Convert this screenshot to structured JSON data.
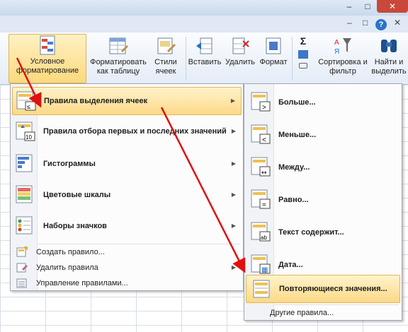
{
  "window": {
    "minimize": "–",
    "maximize": "□",
    "close": "✕",
    "sub_minimize": "–",
    "sub_restore": "□",
    "sub_close": "✕",
    "help": "?"
  },
  "ribbon": {
    "conditional_formatting": "Условное форматирование",
    "format_as_table": "Форматировать как таблицу",
    "cell_styles": "Стили ячеек",
    "insert": "Вставить",
    "delete": "Удалить",
    "format": "Формат",
    "sort_filter": "Сортировка и фильтр",
    "find_select": "Найти и выделить",
    "sigma": "Σ"
  },
  "menu_main": {
    "items": [
      {
        "label": "Правила выделения ячеек",
        "icon": "highlight-rules-icon"
      },
      {
        "label": "Правила отбора первых и последних значений",
        "icon": "top-bottom-icon"
      },
      {
        "label": "Гистограммы",
        "icon": "data-bars-icon"
      },
      {
        "label": "Цветовые шкалы",
        "icon": "color-scales-icon"
      },
      {
        "label": "Наборы значков",
        "icon": "icon-sets-icon"
      }
    ],
    "small_items": [
      {
        "label": "Создать правило..."
      },
      {
        "label": "Удалить правила"
      },
      {
        "label": "Управление правилами..."
      }
    ]
  },
  "menu_sub": {
    "items": [
      {
        "label": "Больше...",
        "glyph": ">"
      },
      {
        "label": "Меньше...",
        "glyph": "<"
      },
      {
        "label": "Между...",
        "glyph": "↔"
      },
      {
        "label": "Равно...",
        "glyph": "="
      },
      {
        "label": "Текст содержит...",
        "glyph": "ab"
      },
      {
        "label": "Дата...",
        "glyph": "▦"
      },
      {
        "label": "Повторяющиеся значения...",
        "glyph": ""
      }
    ],
    "other_rules": "Другие правила..."
  },
  "colors": {
    "highlight": "#fcd987",
    "annotation_arrow": "#e01010",
    "ribbon_bg": "#e4ecf7"
  }
}
